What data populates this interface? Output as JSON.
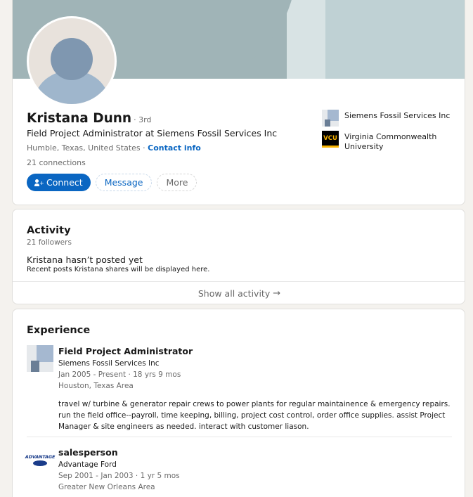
{
  "profile": {
    "name": "Kristana Dunn",
    "degree": "· 3rd",
    "headline": "Field Project Administrator at Siemens Fossil Services Inc",
    "location": "Humble, Texas, United States ·",
    "contact_info": "Contact info",
    "connections": "21 connections",
    "buttons": {
      "connect": "Connect",
      "message": "Message",
      "more": "More"
    },
    "orgs": [
      {
        "name": "Siemens Fossil Services Inc",
        "icon": "siemens-logo"
      },
      {
        "name": "Virginia Commonwealth University",
        "icon": "vcu-logo",
        "logo_text": "VCU"
      }
    ],
    "colors": {
      "accent": "#0a66c2",
      "banner": "#a0b4b7"
    }
  },
  "activity": {
    "title": "Activity",
    "followers": "21 followers",
    "empty_title": "Kristana hasn’t posted yet",
    "empty_subtitle": "Recent posts Kristana shares will be displayed here.",
    "show_all": "Show all activity",
    "arrow": "→"
  },
  "experience": {
    "title": "Experience",
    "items": [
      {
        "title": "Field Project Administrator",
        "company": "Siemens Fossil Services Inc",
        "dates": "Jan 2005 - Present · 18 yrs 9 mos",
        "location": "Houston, Texas Area",
        "description": "travel w/ turbine & generator repair crews to power plants for regular maintainence & emergency repairs. run the field office--payroll, time keeping, billing, project cost control, order office supplies. assist Project Manager & site engineers as needed. interact with customer liason."
      },
      {
        "title": "salesperson",
        "company": "Advantage Ford",
        "dates": "Sep 2001 - Jan 2003 · 1 yr 5 mos",
        "location": "Greater New Orleans Area",
        "logo_text": "ADVANTAGE"
      }
    ]
  }
}
